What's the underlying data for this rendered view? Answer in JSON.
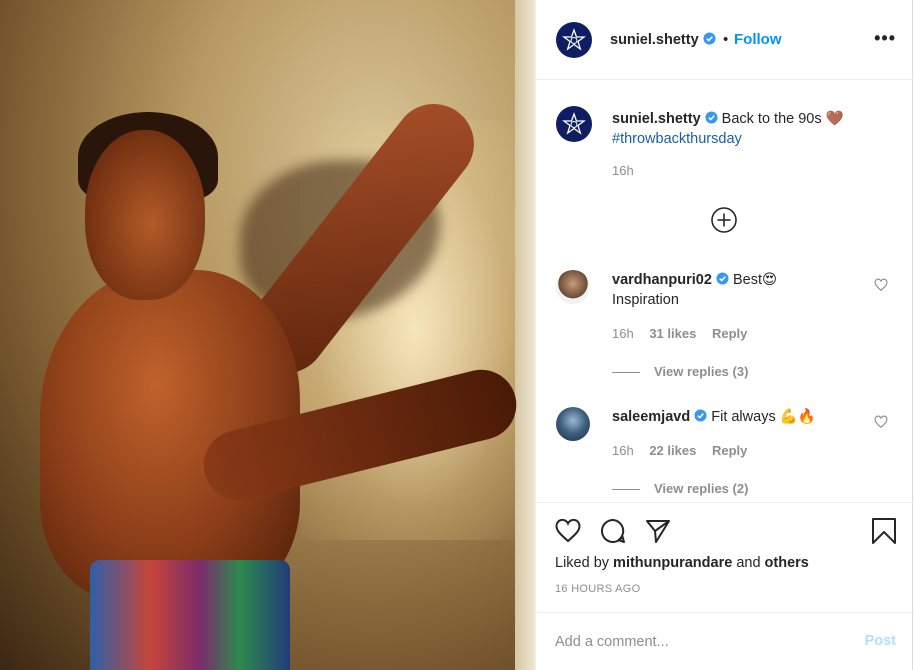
{
  "post": {
    "username": "suniel.shetty",
    "follow_label": "Follow",
    "separator": "•",
    "more_label": "•••"
  },
  "caption": {
    "username": "suniel.shetty",
    "text": "Back to the 90s 🤎",
    "hashtag": "#throwbackthursday",
    "time": "16h"
  },
  "comments": [
    {
      "username": "vardhanpuri02",
      "text": "Best😍",
      "text2": "Inspiration",
      "time": "16h",
      "likes": "31 likes",
      "reply_label": "Reply",
      "view_replies": "View replies (3)"
    },
    {
      "username": "saleemjavd",
      "text": "Fit always 💪🔥",
      "time": "16h",
      "likes": "22 likes",
      "reply_label": "Reply",
      "view_replies": "View replies (2)"
    }
  ],
  "likes_summary": {
    "prefix": "Liked by",
    "user": "mithunpurandare",
    "joiner": "and",
    "others": "others"
  },
  "timestamp": "16 HOURS AGO",
  "add_comment": {
    "placeholder": "Add a comment...",
    "post_label": "Post"
  },
  "colors": {
    "link": "#0095f6",
    "hashtag": "#1a5fa8",
    "muted": "#8e8e8e",
    "post_disabled": "#b2dffc",
    "logo_bg": "#0f1d63"
  },
  "icons": [
    "verified-badge-icon",
    "more-options-icon",
    "load-more-comments-icon",
    "heart-icon",
    "comment-icon",
    "share-icon",
    "bookmark-icon"
  ]
}
